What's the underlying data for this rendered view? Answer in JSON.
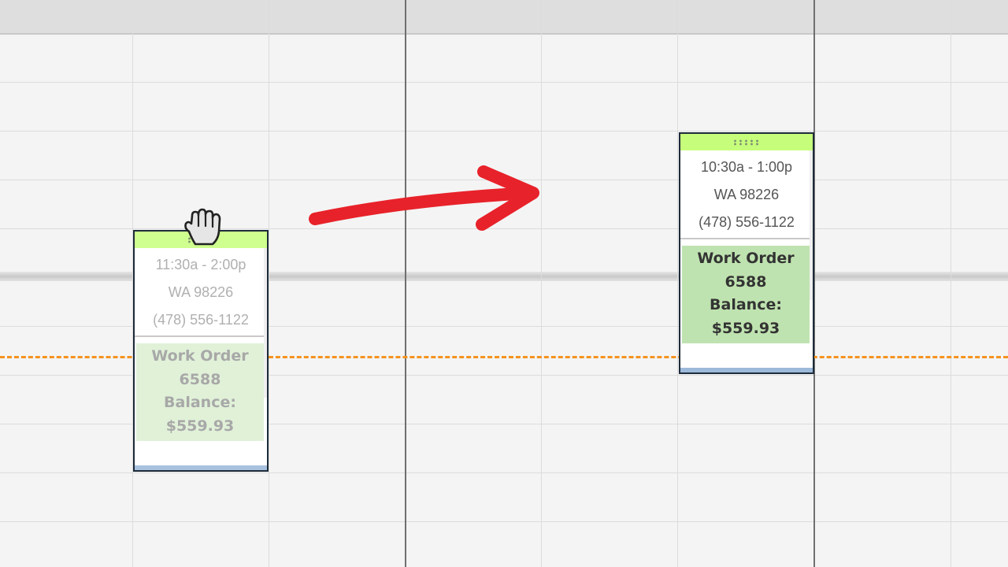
{
  "colors": {
    "grip": "#c6fe7b",
    "work_order_bg": "#bfe3b0",
    "current_time_line": "#f5931f",
    "arrow": "#e8222a"
  },
  "ghost_appointment": {
    "time": "11:30a - 2:00p",
    "zip": "WA 98226",
    "phone": "(478) 556-1122",
    "work_order_line1": "Work Order",
    "work_order_line2": "6588",
    "balance_label": "Balance:",
    "balance_value": "$559.93"
  },
  "moved_appointment": {
    "time": "10:30a - 1:00p",
    "zip": "WA 98226",
    "phone": "(478) 556-1122",
    "work_order_line1": "Work Order",
    "work_order_line2": "6588",
    "balance_label": "Balance:",
    "balance_value": "$559.93"
  },
  "icons": {
    "drag_cursor": "grab-hand-icon",
    "move_arrow": "curved-arrow-icon"
  }
}
